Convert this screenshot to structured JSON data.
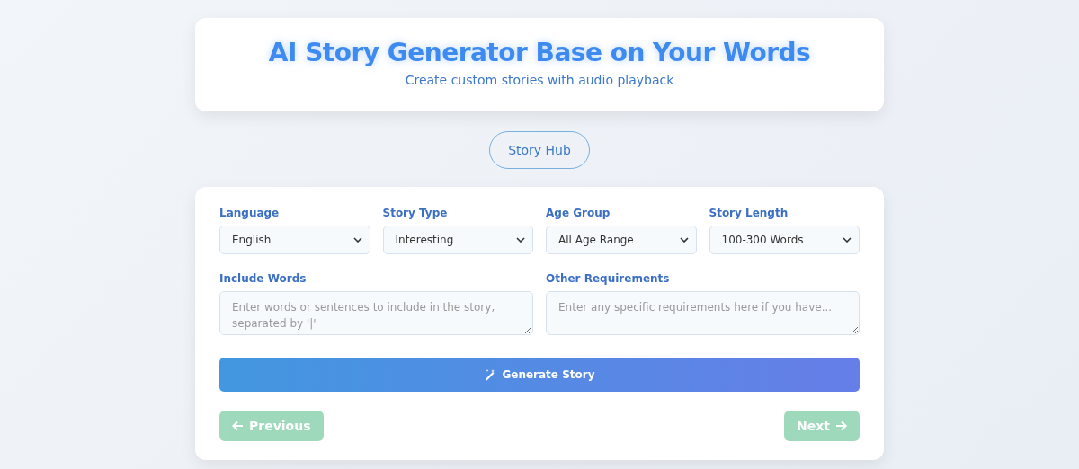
{
  "header": {
    "title": "AI Story Generator Base on Your Words",
    "subtitle": "Create custom stories with audio playback"
  },
  "hub_button": "Story Hub",
  "selects": [
    {
      "label": "Language",
      "value": "English"
    },
    {
      "label": "Story Type",
      "value": "Interesting"
    },
    {
      "label": "Age Group",
      "value": "All Age Range"
    },
    {
      "label": "Story Length",
      "value": "100-300 Words"
    }
  ],
  "text_areas": [
    {
      "label": "Include Words",
      "placeholder": "Enter words or sentences to include in the story, separated by '|'"
    },
    {
      "label": "Other Requirements",
      "placeholder": "Enter any specific requirements here if you have..."
    }
  ],
  "generate_button": "Generate Story",
  "nav_buttons": [
    {
      "kind": "previous",
      "label": "Previous",
      "disabled": true
    },
    {
      "kind": "next",
      "label": "Next",
      "disabled": true
    }
  ]
}
